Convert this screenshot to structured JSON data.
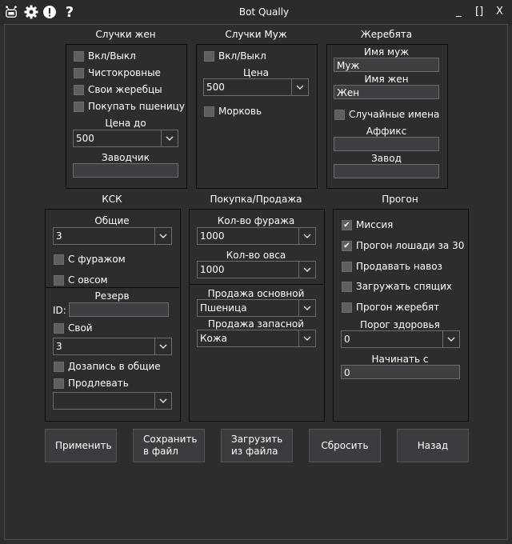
{
  "window": {
    "title": "Bot Qually",
    "min": "_",
    "max": "[]",
    "close": "X"
  },
  "mares": {
    "title": "Случки жен",
    "onoff": "Вкл/Выкл",
    "pure": "Чистокровные",
    "own": "Свои жеребцы",
    "buy_wheat": "Покупать пшеницу",
    "price_label": "Цена до",
    "price_value": "500",
    "breeder_label": "Заводчик",
    "breeder_value": ""
  },
  "stallions": {
    "title": "Случки Муж",
    "onoff": "Вкл/Выкл",
    "price_label": "Цена",
    "price_value": "500",
    "carrot": "Морковь"
  },
  "foals": {
    "title": "Жеребята",
    "male_label": "Имя муж",
    "male_value": "Муж",
    "female_label": "Имя жен",
    "female_value": "Жен",
    "random": "Случайные имена",
    "affix_label": "Аффикс",
    "affix_value": "",
    "farm_label": "Завод",
    "farm_value": ""
  },
  "ksk": {
    "title": "КСК",
    "general_label": "Общие",
    "general_value": "3",
    "with_feed": "С фуражом",
    "with_oats": "С овсом",
    "reserve_label": "Резерв",
    "id_label": "ID:",
    "id_value": "",
    "own": "Свой",
    "own_value": "3",
    "add_general": "Дозапись в общие",
    "extend": "Продлевать",
    "extend_value": ""
  },
  "trade": {
    "title": "Покупка/Продажа",
    "feed_label": "Кол-во фуража",
    "feed_value": "1000",
    "oats_label": "Кол-во овса",
    "oats_value": "1000",
    "main_sale_label": "Продажа основной",
    "main_sale_value": "Пшеница",
    "spare_sale_label": "Продажа запасной",
    "spare_sale_value": "Кожа"
  },
  "run": {
    "title": "Прогон",
    "mission": "Миссия",
    "run30": "Прогон лошади за 30",
    "sell_manure": "Продавать навоз",
    "load_sleeping": "Загружать спящих",
    "run_foals": "Прогон жеребят",
    "health_label": "Порог здоровья",
    "health_value": "0",
    "start_label": "Начинать с",
    "start_value": "0"
  },
  "buttons": {
    "apply": "Применить",
    "save": "Сохранить в файл",
    "load": "Загрузить из файла",
    "reset": "Сбросить",
    "back": "Назад"
  }
}
